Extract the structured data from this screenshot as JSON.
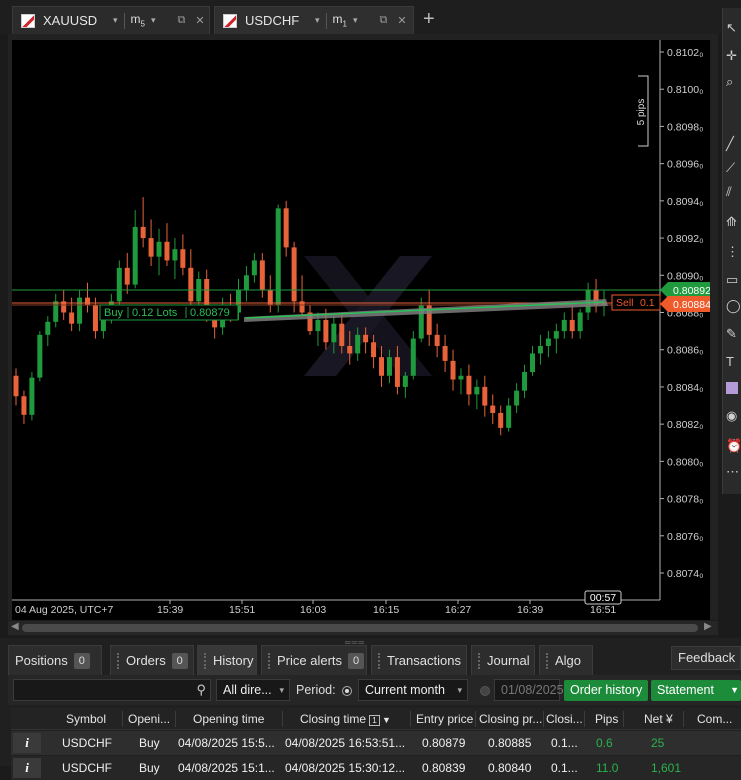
{
  "tabs": [
    {
      "symbol": "XAUUSD",
      "timeframe": "m",
      "timeframe_sub": "5"
    },
    {
      "symbol": "USDCHF",
      "timeframe": "m",
      "timeframe_sub": "1"
    }
  ],
  "chart": {
    "price_levels": [
      "0.8102₀",
      "0.8100₀",
      "0.8098₀",
      "0.8096₀",
      "0.8094₀",
      "0.8092₀",
      "0.8090₀",
      "0.8088₀",
      "0.8086₀",
      "0.8084₀",
      "0.8082₀",
      "0.8080₀",
      "0.8078₀",
      "0.8076₀",
      "0.8074₀"
    ],
    "time_labels": [
      "04 Aug 2025, UTC+7",
      "15:39",
      "15:51",
      "16:03",
      "16:15",
      "16:27",
      "16:39",
      "16:51"
    ],
    "countdown": "00:57",
    "scale_label": "5 pips",
    "buy_line": {
      "side": "Buy",
      "lots": "0.12 Lots",
      "price": "0.80879"
    },
    "sell_line": {
      "side": "Sell",
      "lots": "0.1",
      "price": "0.80884"
    },
    "current_price": "0.80892",
    "colors": {
      "bull": "#1f9b3e",
      "bear": "#e8633a",
      "ask": "#1f9b3e",
      "bid": "#ef5a2a"
    }
  },
  "chart_data": {
    "type": "candlestick",
    "symbol": "USDCHF",
    "timeframe": "m1",
    "ylim": [
      0.8073,
      0.8103
    ],
    "x": [
      "15:39",
      "15:51",
      "16:03",
      "16:15",
      "16:27",
      "16:39",
      "16:51"
    ],
    "ohlc": [
      [
        0.80846,
        0.8085,
        0.8083,
        0.80835
      ],
      [
        0.80835,
        0.80838,
        0.8082,
        0.80825
      ],
      [
        0.80825,
        0.80848,
        0.80822,
        0.80845
      ],
      [
        0.80845,
        0.8087,
        0.80843,
        0.80868
      ],
      [
        0.80868,
        0.80878,
        0.80862,
        0.80875
      ],
      [
        0.80875,
        0.8089,
        0.80872,
        0.80886
      ],
      [
        0.80886,
        0.80892,
        0.80876,
        0.8088
      ],
      [
        0.8088,
        0.80888,
        0.8087,
        0.80874
      ],
      [
        0.80874,
        0.80892,
        0.8087,
        0.80888
      ],
      [
        0.80888,
        0.80896,
        0.8088,
        0.80884
      ],
      [
        0.80884,
        0.80888,
        0.80866,
        0.8087
      ],
      [
        0.8087,
        0.8088,
        0.80866,
        0.80878
      ],
      [
        0.80878,
        0.8089,
        0.80874,
        0.80886
      ],
      [
        0.80886,
        0.80908,
        0.80882,
        0.80904
      ],
      [
        0.80904,
        0.80912,
        0.8089,
        0.80895
      ],
      [
        0.80895,
        0.80935,
        0.80893,
        0.80926
      ],
      [
        0.80926,
        0.80942,
        0.80915,
        0.8092
      ],
      [
        0.8092,
        0.8093,
        0.80905,
        0.8091
      ],
      [
        0.8091,
        0.80925,
        0.809,
        0.80918
      ],
      [
        0.80918,
        0.80928,
        0.80905,
        0.80908
      ],
      [
        0.80908,
        0.8092,
        0.80898,
        0.80914
      ],
      [
        0.80914,
        0.80922,
        0.809,
        0.80904
      ],
      [
        0.80904,
        0.80914,
        0.8088,
        0.80886
      ],
      [
        0.80886,
        0.80902,
        0.80882,
        0.80898
      ],
      [
        0.80898,
        0.80903,
        0.80875,
        0.8088
      ],
      [
        0.8088,
        0.80884,
        0.80866,
        0.80872
      ],
      [
        0.80872,
        0.80888,
        0.80868,
        0.80884
      ],
      [
        0.80884,
        0.8089,
        0.80875,
        0.8088
      ],
      [
        0.8088,
        0.80898,
        0.80876,
        0.80892
      ],
      [
        0.80892,
        0.80905,
        0.80886,
        0.809
      ],
      [
        0.809,
        0.80912,
        0.80896,
        0.80908
      ],
      [
        0.80908,
        0.80912,
        0.80888,
        0.80892
      ],
      [
        0.80892,
        0.809,
        0.8088,
        0.80884
      ],
      [
        0.80884,
        0.80938,
        0.8088,
        0.80936
      ],
      [
        0.80936,
        0.8094,
        0.8091,
        0.80915
      ],
      [
        0.80915,
        0.80918,
        0.8088,
        0.80886
      ],
      [
        0.80886,
        0.809,
        0.80878,
        0.8088
      ],
      [
        0.8088,
        0.80884,
        0.80868,
        0.8087
      ],
      [
        0.8087,
        0.8088,
        0.80862,
        0.80876
      ],
      [
        0.80876,
        0.80882,
        0.8086,
        0.80864
      ],
      [
        0.80864,
        0.80878,
        0.80858,
        0.80874
      ],
      [
        0.80874,
        0.8088,
        0.80858,
        0.80862
      ],
      [
        0.80862,
        0.8087,
        0.80852,
        0.80858
      ],
      [
        0.80858,
        0.80872,
        0.80854,
        0.80868
      ],
      [
        0.80868,
        0.80872,
        0.80858,
        0.80864
      ],
      [
        0.80864,
        0.80868,
        0.8085,
        0.80856
      ],
      [
        0.80856,
        0.80862,
        0.8084,
        0.80846
      ],
      [
        0.80846,
        0.8086,
        0.80842,
        0.80856
      ],
      [
        0.80856,
        0.80862,
        0.80836,
        0.8084
      ],
      [
        0.8084,
        0.80848,
        0.80834,
        0.80846
      ],
      [
        0.80846,
        0.8087,
        0.80844,
        0.80866
      ],
      [
        0.80866,
        0.80888,
        0.80864,
        0.80884
      ],
      [
        0.80884,
        0.80892,
        0.80862,
        0.80868
      ],
      [
        0.80868,
        0.80874,
        0.80856,
        0.80862
      ],
      [
        0.80862,
        0.80868,
        0.80848,
        0.80854
      ],
      [
        0.80854,
        0.8086,
        0.80838,
        0.80844
      ],
      [
        0.80844,
        0.8085,
        0.80836,
        0.80846
      ],
      [
        0.80846,
        0.80852,
        0.8083,
        0.80836
      ],
      [
        0.80836,
        0.80844,
        0.80828,
        0.8084
      ],
      [
        0.8084,
        0.80846,
        0.80824,
        0.8083
      ],
      [
        0.8083,
        0.80836,
        0.8082,
        0.80826
      ],
      [
        0.80826,
        0.8083,
        0.80814,
        0.80818
      ],
      [
        0.80818,
        0.80834,
        0.80816,
        0.8083
      ],
      [
        0.8083,
        0.80842,
        0.80826,
        0.80838
      ],
      [
        0.80838,
        0.80852,
        0.80834,
        0.80848
      ],
      [
        0.80848,
        0.80862,
        0.80846,
        0.80858
      ],
      [
        0.80858,
        0.80868,
        0.80852,
        0.80862
      ],
      [
        0.80862,
        0.8087,
        0.80856,
        0.80866
      ],
      [
        0.80866,
        0.80874,
        0.80858,
        0.8087
      ],
      [
        0.8087,
        0.8088,
        0.80866,
        0.80876
      ],
      [
        0.80876,
        0.80884,
        0.80866,
        0.8087
      ],
      [
        0.8087,
        0.80882,
        0.80866,
        0.8088
      ],
      [
        0.8088,
        0.80896,
        0.80876,
        0.80892
      ],
      [
        0.80892,
        0.80898,
        0.8088,
        0.80884
      ],
      [
        0.80884,
        0.80892,
        0.80878,
        0.80886
      ]
    ]
  },
  "bottom_tabs": [
    {
      "label": "Positions",
      "count": "0"
    },
    {
      "label": "Orders",
      "count": "0"
    },
    {
      "label": "History",
      "count": ""
    },
    {
      "label": "Price alerts",
      "count": "0"
    },
    {
      "label": "Transactions",
      "count": ""
    },
    {
      "label": "Journal",
      "count": ""
    },
    {
      "label": "Algo",
      "count": ""
    }
  ],
  "feedback_label": "Feedback",
  "filters": {
    "direction": "All dire...",
    "period_label": "Period:",
    "period_value": "Current month",
    "date_value": "01/08/2025",
    "order_history_btn": "Order history",
    "statement_btn": "Statement"
  },
  "table": {
    "headers": [
      "Symbol",
      "Openi...",
      "Opening time",
      "Closing time",
      "Entry price",
      "Closing pr...",
      "Closi...",
      "Pips",
      "Net ¥",
      "Com..."
    ],
    "sort_badge": "1",
    "rows": [
      [
        "USDCHF",
        "Buy",
        "04/08/2025 15:5...",
        "04/08/2025 16:53:51...",
        "0.80879",
        "0.80885",
        "0.1...",
        "0.6",
        "25",
        ""
      ],
      [
        "USDCHF",
        "Buy",
        "04/08/2025 15:1...",
        "04/08/2025 15:30:12...",
        "0.80839",
        "0.80840",
        "0.1...",
        "11.0",
        "1,601",
        ""
      ]
    ]
  }
}
